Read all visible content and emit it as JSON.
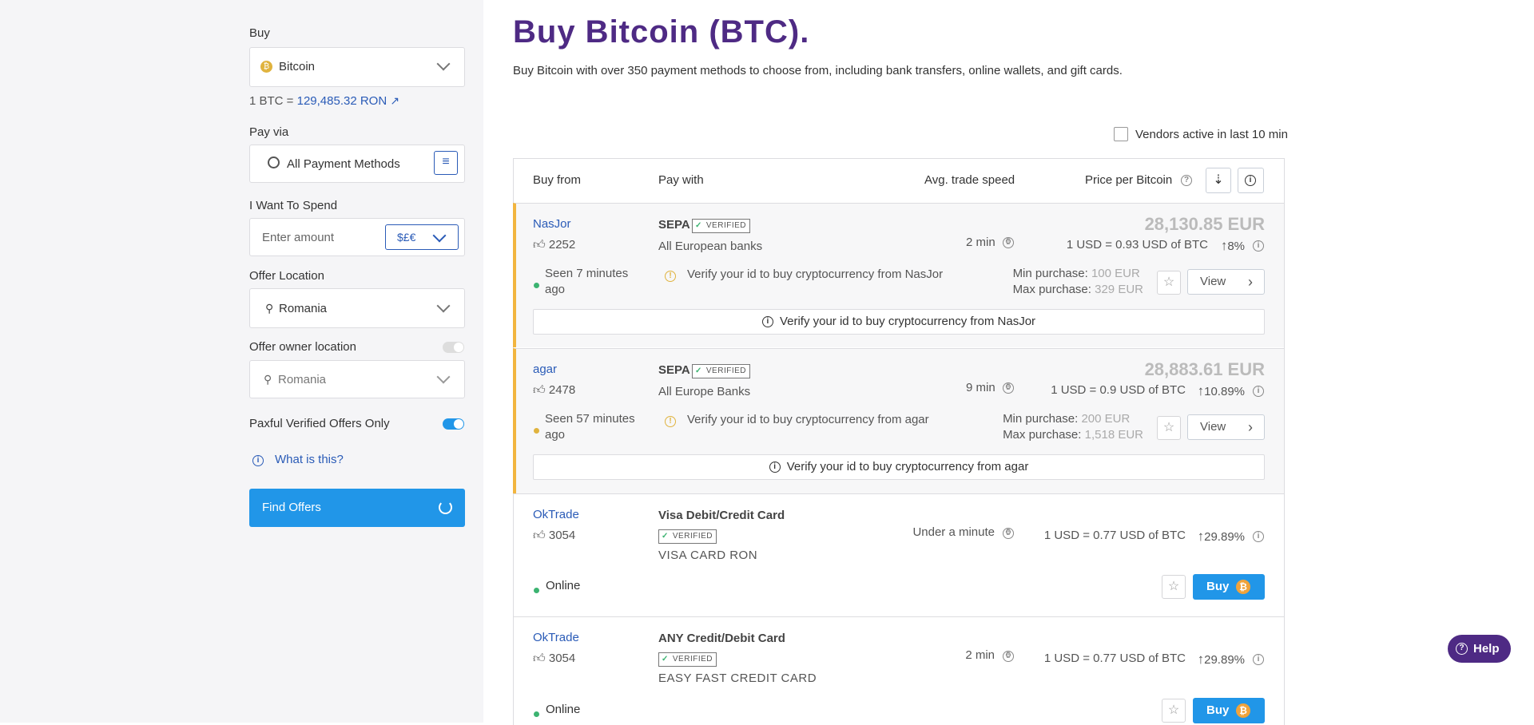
{
  "sidebar": {
    "buy_label": "Buy",
    "crypto_select": "Bitcoin",
    "rate_prefix": "1 BTC =",
    "rate_value": "129,485.32 RON",
    "pay_via_label": "Pay via",
    "payment_methods": "All Payment Methods",
    "spend_label": "I Want To Spend",
    "amount_placeholder": "Enter amount",
    "currency_symbol": "$£€",
    "offer_location_label": "Offer Location",
    "offer_location": "Romania",
    "owner_location_label": "Offer owner location",
    "owner_location": "Romania",
    "verified_only_label": "Paxful Verified Offers Only",
    "what_is_this": "What is this?",
    "find_offers": "Find Offers"
  },
  "main": {
    "title": "Buy Bitcoin (BTC).",
    "subtitle": "Buy Bitcoin with over 350 payment methods to choose from, including bank transfers, online wallets, and gift cards.",
    "vendors_active": "Vendors active in last 10 min",
    "headers": {
      "buy_from": "Buy from",
      "pay_with": "Pay with",
      "speed": "Avg. trade speed",
      "price": "Price per Bitcoin"
    },
    "offers": [
      {
        "vendor": "NasJor",
        "likes": "2252",
        "seen": "Seen 7 minutes ago",
        "method": "SEPA",
        "verified": "VERIFIED",
        "detail": "All European banks",
        "verify_note": "Verify your id to buy cryptocurrency from NasJor",
        "speed": "2 min",
        "price": "28,130.85 EUR",
        "rate": "1 USD = 0.93 USD of BTC",
        "margin": "8%",
        "min_label": "Min purchase:",
        "min_value": "100 EUR",
        "max_label": "Max purchase:",
        "max_value": "329 EUR",
        "action": "View"
      },
      {
        "vendor": "agar",
        "likes": "2478",
        "seen": "Seen 57 minutes ago",
        "method": "SEPA",
        "verified": "VERIFIED",
        "detail": "All Europe Banks",
        "verify_note": "Verify your id to buy cryptocurrency from agar",
        "speed": "9 min",
        "price": "28,883.61 EUR",
        "rate": "1 USD = 0.9 USD of BTC",
        "margin": "10.89%",
        "min_label": "Min purchase:",
        "min_value": "200 EUR",
        "max_label": "Max purchase:",
        "max_value": "1,518 EUR",
        "action": "View"
      },
      {
        "vendor": "OkTrade",
        "likes": "3054",
        "status": "Online",
        "method": "Visa Debit/Credit Card",
        "verified": "VERIFIED",
        "detail": "VISA CARD RON",
        "speed": "Under a minute",
        "rate": "1 USD = 0.77 USD of BTC",
        "margin": "29.89%",
        "action": "Buy"
      },
      {
        "vendor": "OkTrade",
        "likes": "3054",
        "status": "Online",
        "method": "ANY Credit/Debit Card",
        "verified": "VERIFIED",
        "detail": "EASY FAST CREDIT CARD",
        "speed": "2 min",
        "rate": "1 USD = 0.77 USD of BTC",
        "margin": "29.89%",
        "action": "Buy"
      }
    ]
  },
  "help_label": "Help",
  "colors": {
    "accent_blue": "#2196e8",
    "link_blue": "#2a5bb7",
    "title_purple": "#4e2a84",
    "highlight_orange": "#f2b53f",
    "online_green": "#3cb371"
  }
}
